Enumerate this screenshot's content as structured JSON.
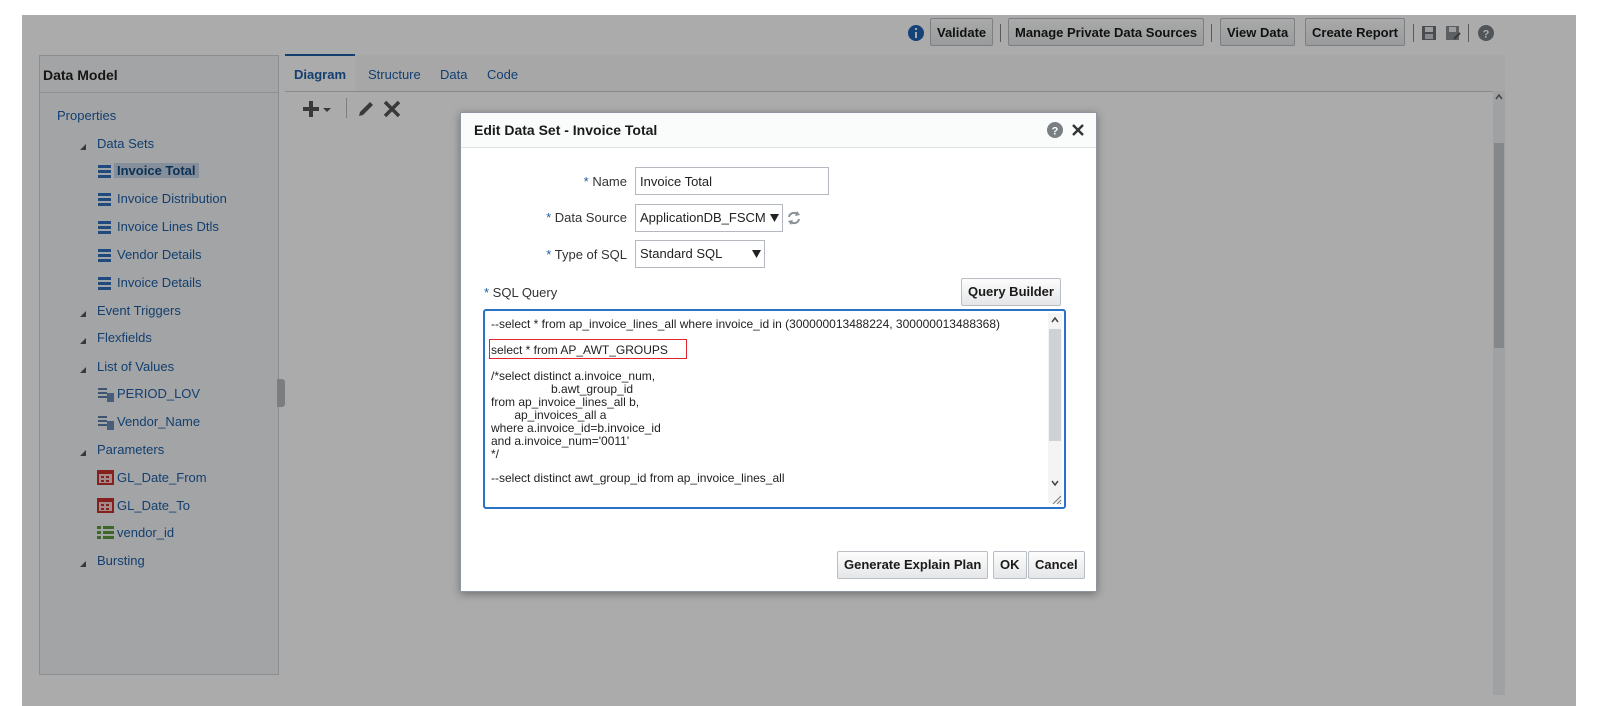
{
  "toolbar": {
    "validate": "Validate",
    "manage_private": "Manage Private Data Sources",
    "view_data": "View Data",
    "create_report": "Create Report"
  },
  "left_panel": {
    "title": "Data Model",
    "properties": "Properties",
    "data_sets_label": "Data Sets",
    "data_sets": [
      "Invoice Total",
      "Invoice Distribution",
      "Invoice Lines Dtls",
      "Vendor Details",
      "Invoice Details"
    ],
    "event_triggers": "Event Triggers",
    "flexfields": "Flexfields",
    "list_of_values_label": "List of Values",
    "list_of_values": [
      "PERIOD_LOV",
      "Vendor_Name"
    ],
    "parameters_label": "Parameters",
    "parameters": [
      "GL_Date_From",
      "GL_Date_To",
      "vendor_id"
    ],
    "bursting": "Bursting"
  },
  "tabs": [
    "Diagram",
    "Structure",
    "Data",
    "Code"
  ],
  "dialog": {
    "title": "Edit Data Set - Invoice Total",
    "name_label": "Name",
    "name_value": "Invoice Total",
    "data_source_label": "Data Source",
    "data_source_value": "ApplicationDB_FSCM",
    "type_sql_label": "Type of SQL",
    "type_sql_value": "Standard SQL",
    "sql_query_label": "SQL Query",
    "query_builder": "Query Builder",
    "sql_lines": [
      "--select * from ap_invoice_lines_all where invoice_id in (300000013488224, 300000013488368)",
      "select * from AP_AWT_GROUPS",
      "/*select distinct a.invoice_num,",
      "                  b.awt_group_id",
      "from ap_invoice_lines_all b,",
      "       ap_invoices_all a",
      "where a.invoice_id=b.invoice_id",
      "and a.invoice_num='0011'",
      "*/",
      "--select distinct awt_group_id from ap_invoice_lines_all"
    ],
    "generate_plan": "Generate Explain Plan",
    "ok": "OK",
    "cancel": "Cancel"
  },
  "colors": {
    "accent": "#1d5fa8",
    "highlight_box": "#e0262b",
    "sql_border": "#2a72c5"
  }
}
